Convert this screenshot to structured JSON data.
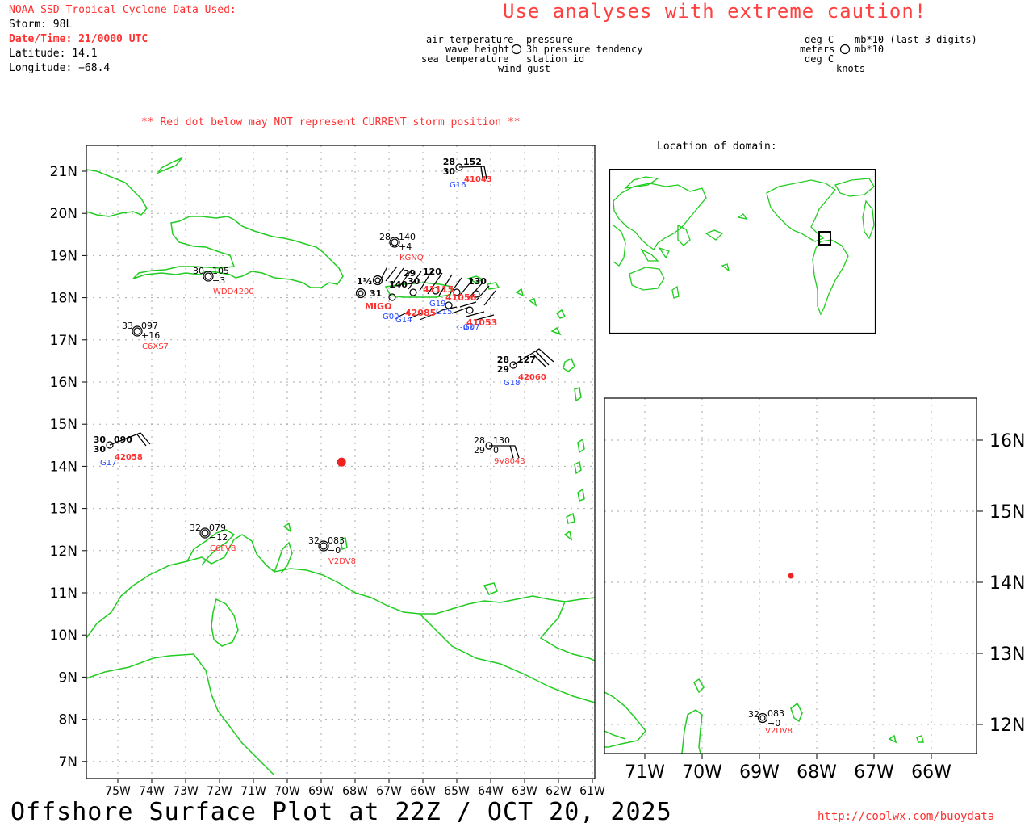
{
  "header": {
    "source_title": "NOAA SSD Tropical Cyclone Data Used:",
    "storm": "Storm: 98L",
    "datetime": "Date/Time: 21/0000 UTC",
    "latitude": "Latitude: 14.1",
    "longitude": "Longitude: −68.4",
    "caution": "Use analyses with extreme caution!",
    "red_dot_note": "** Red dot below may NOT represent CURRENT storm position **"
  },
  "legend": {
    "air_temperature": "air temperature",
    "wave_height": "wave height",
    "sea_temperature": "sea temperature",
    "wind_gust": "wind gust",
    "pressure": "pressure",
    "pressure_tendency": "3h pressure tendency",
    "station_id": "station id",
    "deg_c_1": "deg C",
    "meters": "meters",
    "deg_c_2": "deg C",
    "knots": "knots",
    "mb_last3": "mb*10 (last 3 digits)",
    "mb": "mb*10"
  },
  "inset": {
    "title": "Location of domain:"
  },
  "main_map": {
    "lat_labels": [
      "21N",
      "20N",
      "19N",
      "18N",
      "17N",
      "16N",
      "15N",
      "14N",
      "13N",
      "12N",
      "11N",
      "10N",
      "9N",
      "8N",
      "7N"
    ],
    "lon_labels": [
      "75W",
      "74W",
      "73W",
      "72W",
      "71W",
      "70W",
      "69W",
      "68W",
      "67W",
      "66W",
      "65W",
      "64W",
      "63W",
      "62W",
      "61W"
    ],
    "storm_position": {
      "lat": 14.1,
      "lon": -68.4
    },
    "stations": [
      {
        "id": "41043",
        "air": "28",
        "sea": "30",
        "pres": "152",
        "ptend": "",
        "gust": "G16"
      },
      {
        "id": "KGNQ",
        "air": "28",
        "sea": "",
        "pres": "140",
        "ptend": "+4",
        "gust": ""
      },
      {
        "id": "WDD4200",
        "air": "30",
        "sea": "",
        "pres": "105",
        "ptend": "−3",
        "gust": ""
      },
      {
        "id": "C6XS7",
        "air": "33",
        "sea": "",
        "pres": "097",
        "ptend": "+16",
        "gust": ""
      },
      {
        "id": "42060",
        "air": "28",
        "sea": "29",
        "pres": "127",
        "ptend": "",
        "gust": "G18"
      },
      {
        "id": "42058",
        "air": "30",
        "sea": "30",
        "pres": "090",
        "ptend": "",
        "gust": "G17"
      },
      {
        "id": "9V8043",
        "air": "28",
        "sea": "29",
        "pres": "130",
        "ptend": "0",
        "gust": ""
      },
      {
        "id": "C6FV8",
        "air": "32",
        "sea": "",
        "pres": "079",
        "ptend": "−12",
        "gust": ""
      },
      {
        "id": "V2DV8",
        "air": "32",
        "sea": "",
        "pres": "083",
        "ptend": "−0",
        "gust": ""
      }
    ],
    "cluster_labels": [
      "1½",
      "31",
      "140",
      "29",
      "120",
      "30",
      "130",
      "MIGO",
      "G00",
      "G19",
      "G15",
      "G03",
      "G07",
      "G14",
      "42085",
      "41115",
      "41056",
      "41053"
    ]
  },
  "zoom_map": {
    "lat_labels": [
      "16N",
      "15N",
      "14N",
      "13N",
      "12N"
    ],
    "lon_labels": [
      "71W",
      "70W",
      "69W",
      "68W",
      "67W",
      "66W"
    ],
    "station": {
      "id": "V2DV8",
      "air": "32",
      "pres": "083",
      "ptend": "−0"
    }
  },
  "footer": {
    "title": "Offshore Surface Plot at 22Z / OCT 20, 2025",
    "url": "http://coolwx.com/buoydata"
  },
  "colors": {
    "land": "#22cc22",
    "storm": "#ee2222",
    "text_red": "#ff3030",
    "id_blue": "#2244ff"
  }
}
